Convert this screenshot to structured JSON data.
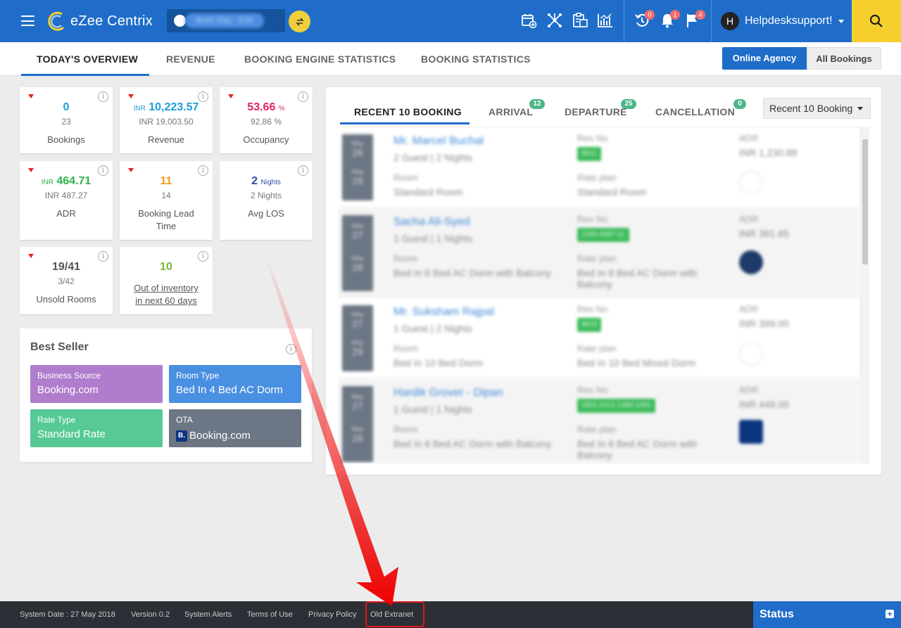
{
  "app": {
    "logo_text": "eZee Centrix",
    "property_name": "Bunk Stay - B2B"
  },
  "header": {
    "user_initial": "H",
    "user_name": "Helpdesksupport!",
    "badges": {
      "history": "0",
      "notifications": "1",
      "flags": "4"
    }
  },
  "tabs": [
    {
      "label": "TODAY'S OVERVIEW"
    },
    {
      "label": "REVENUE"
    },
    {
      "label": "BOOKING ENGINE STATISTICS"
    },
    {
      "label": "BOOKING STATISTICS"
    }
  ],
  "filters": {
    "online_agency": "Online Agency",
    "all_bookings": "All Bookings"
  },
  "kpis": {
    "bookings": {
      "value": "0",
      "previous": "23",
      "label": "Bookings",
      "color": "#1aa0d8"
    },
    "revenue": {
      "currency": "INR",
      "value": "10,223.57",
      "previous": "INR 19,003.50",
      "label": "Revenue",
      "color": "#1aa0d8"
    },
    "occupancy": {
      "value": "53.66",
      "unit": "%",
      "previous": "92.86 %",
      "label": "Occupancy",
      "color": "#e0245e"
    },
    "adr": {
      "currency": "INR",
      "value": "464.71",
      "previous": "INR 487.27",
      "label": "ADR",
      "color": "#2db34a"
    },
    "lead_time": {
      "value": "11",
      "previous": "14",
      "label_line1": "Booking Lead",
      "label_line2": "Time",
      "color": "#f29b1d"
    },
    "avg_los": {
      "value": "2",
      "unit": "Nights",
      "previous": "2 Nights",
      "label": "Avg LOS",
      "color": "#2f4aa0"
    },
    "unsold": {
      "value": "19/41",
      "previous": "3/42",
      "label": "Unsold Rooms",
      "color": "#555555"
    },
    "out_of_inventory": {
      "value": "10",
      "label_line1": "Out of inventory",
      "label_line2": "in next 60 days",
      "color": "#7db83a"
    }
  },
  "best_seller": {
    "title": "Best Seller",
    "business_source": {
      "key": "Business Source",
      "value": "Booking.com",
      "color": "#b07ccc"
    },
    "room_type": {
      "key": "Room Type",
      "value": "Bed In 4 Bed AC Dorm",
      "color": "#4a90e2"
    },
    "rate_type": {
      "key": "Rate Type",
      "value": "Standard Rate",
      "color": "#56c994"
    },
    "ota": {
      "key": "OTA",
      "value": "Booking.com",
      "logo": "B.",
      "color": "#6c7684"
    }
  },
  "recent": {
    "tabs": [
      {
        "label": "RECENT 10 BOOKING"
      },
      {
        "label": "ARRIVAL",
        "badge": "12"
      },
      {
        "label": "DEPARTURE",
        "badge": "25"
      },
      {
        "label": "CANCELLATION",
        "badge": "0"
      }
    ],
    "select": "Recent 10 Booking",
    "bookings": [
      {
        "m1": "May",
        "d1": "26",
        "m2": "May",
        "d2": "28",
        "name": "Mr. Marcel Buchal",
        "guests": "2 Guest | 2 Nights",
        "room": "Standard Room",
        "res_no": "8611",
        "rate_plan": "Standard Room",
        "adr": "INR 1,230.88",
        "ota": "ezee"
      },
      {
        "m1": "May",
        "d1": "27",
        "m2": "May",
        "d2": "28",
        "name": "Sacha Ali-Syed",
        "guests": "1 Guest | 1 Nights",
        "room": "Bed In 6 Bed AC Dorm with Balcony",
        "res_no": "1245-4087-11",
        "rate_plan": "Bed In 6 Bed AC Dorm with Balcony",
        "adr": "INR 381.65",
        "ota": "globe"
      },
      {
        "m1": "May",
        "d1": "27",
        "m2": "May",
        "d2": "29",
        "name": "Mr. Suksham Rajpal",
        "guests": "1 Guest | 2 Nights",
        "room": "Bed In 10 Bed Dorm",
        "res_no": "8615",
        "rate_plan": "Bed In 10 Bed Mixed Dorm",
        "adr": "INR 399.00",
        "ota": "ezee"
      },
      {
        "m1": "May",
        "d1": "27",
        "m2": "May",
        "d2": "28",
        "name": "Hardik Grover - Dipan",
        "guests": "1 Guest | 1 Nights",
        "room": "Bed In 6 Bed AC Dorm with Balcony",
        "res_no": "1801-2412-1480-1491",
        "rate_plan": "Bed In 6 Bed AC Dorm with Balcony",
        "adr": "INR 449.00",
        "ota": "booking"
      }
    ],
    "field_labels": {
      "res_no": "Res No",
      "room": "Room",
      "rate_plan": "Rate plan",
      "adr": "ADR"
    }
  },
  "footer": {
    "system_date": "System Date : 27 May 2018",
    "version": "Version 0.2",
    "alerts": "System Alerts",
    "terms": "Terms of Use",
    "privacy": "Privacy Policy",
    "old_extranet": "Old Extranet",
    "status": "Status"
  }
}
